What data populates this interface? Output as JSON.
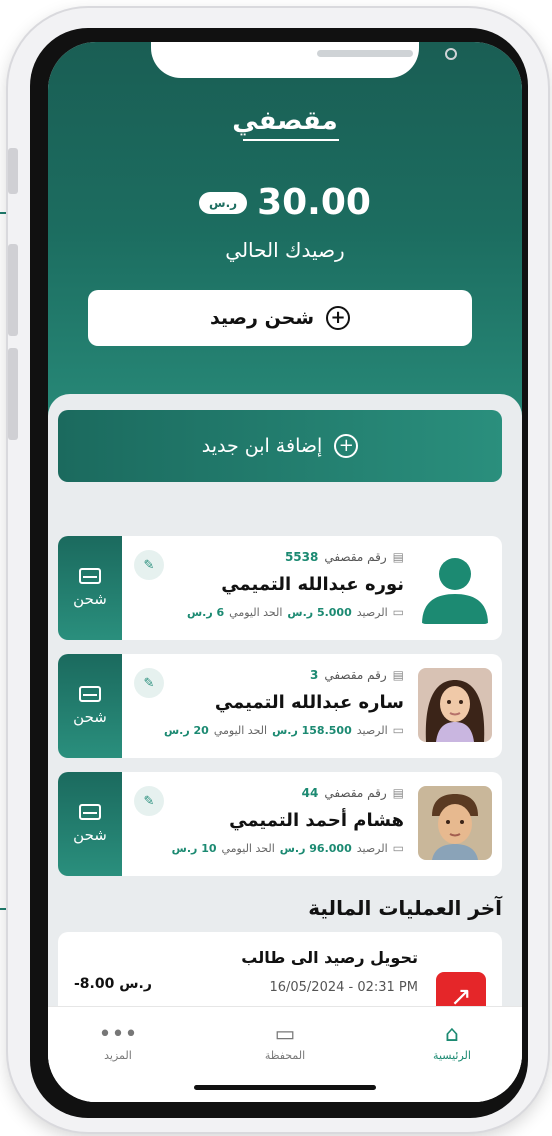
{
  "header": {
    "title": "مقصفي",
    "currency": "ر.س",
    "balance": "30.00",
    "balance_label": "رصيدك الحالي",
    "topup_label": "شحن رصيد"
  },
  "add_child_label": "إضافة ابن جديد",
  "card_labels": {
    "number_label": "رقم مقصفي",
    "balance_label": "الرصيد",
    "limit_label": "الحد اليومي",
    "charge_label": "شحن"
  },
  "children": [
    {
      "number": "5538",
      "name": "نوره عبدالله التميمي",
      "balance": "5.000 ر.س",
      "limit": "6 ر.س"
    },
    {
      "number": "3",
      "name": "ساره عبدالله التميمي",
      "balance": "158.500 ر.س",
      "limit": "20 ر.س"
    },
    {
      "number": "44",
      "name": "هشام أحمد التميمي",
      "balance": "96.000 ر.س",
      "limit": "10 ر.س"
    }
  ],
  "transactions": {
    "section_title": "آخر العمليات المالية",
    "items": [
      {
        "title": "تحويل رصيد الى طالب",
        "date": "16/05/2024 - 02:31 PM",
        "amount": "-8.00 ر.س"
      }
    ]
  },
  "nav": {
    "more": "المزيد",
    "wallet": "المحفظة",
    "home": "الرئيسية"
  },
  "colors": {
    "primary": "#1c6d60",
    "accent": "#1c8a72",
    "danger": "#e52629"
  }
}
